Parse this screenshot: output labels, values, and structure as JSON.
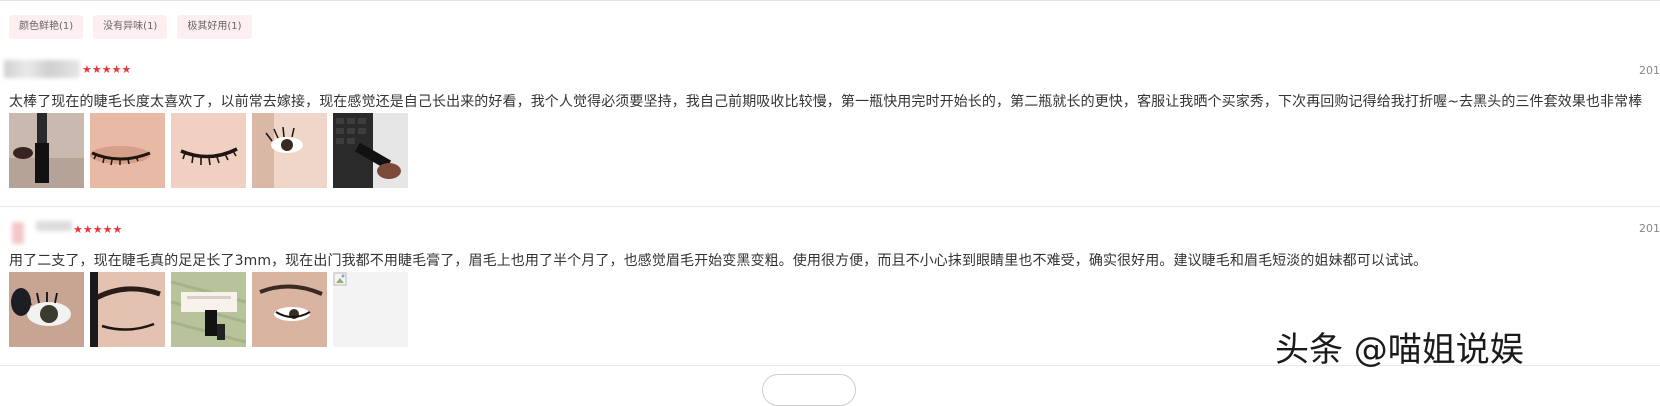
{
  "tags": [
    {
      "label": "颜色鲜艳(1)"
    },
    {
      "label": "没有异味(1)"
    },
    {
      "label": "极其好用(1)"
    }
  ],
  "reviews": [
    {
      "stars": "★★★★★",
      "date": "201",
      "text": "太棒了现在的睫毛长度太喜欢了，以前常去嫁接，现在感觉还是自己长出来的好看，我个人觉得必须要坚持，我自己前期吸收比较慢，第一瓶快用完时开始长的，第二瓶就长的更快，客服让我晒个买家秀，下次再回购记得给我打折喔~去黑头的三件套效果也非常棒"
    },
    {
      "stars": "★★★★★",
      "date": "201",
      "text": "用了二支了，现在睫毛真的足足长了3mm，现在出门我都不用睫毛膏了，眉毛上也用了半个月了，也感觉眉毛开始变黑变粗。使用很方便，而且不小心抹到眼睛里也不难受，确实很好用。建议睫毛和眉毛短淡的姐妹都可以试试。"
    }
  ],
  "watermark": "头条 @喵姐说娱",
  "colors": {
    "star": "#e4393c",
    "tag_bg": "#fdeff0"
  }
}
